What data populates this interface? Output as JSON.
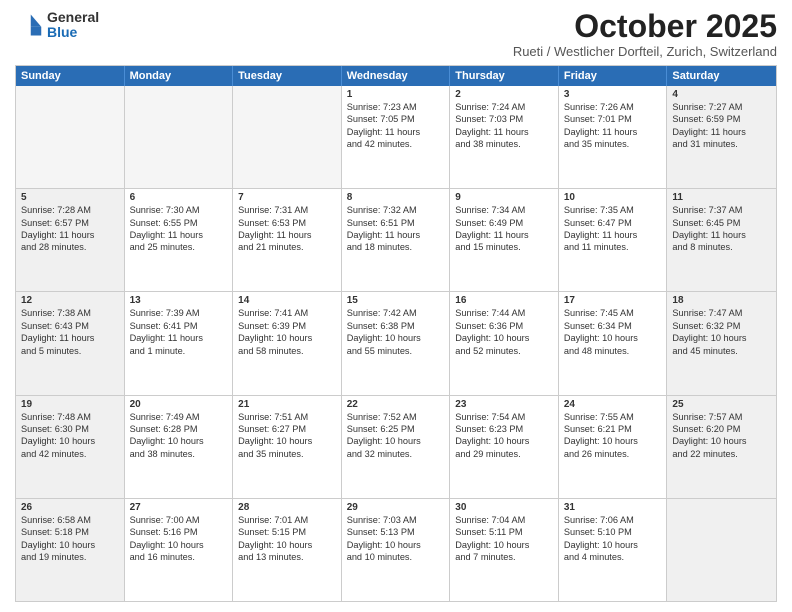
{
  "logo": {
    "general": "General",
    "blue": "Blue"
  },
  "title": "October 2025",
  "subtitle": "Rueti / Westlicher Dorfteil, Zurich, Switzerland",
  "days": [
    "Sunday",
    "Monday",
    "Tuesday",
    "Wednesday",
    "Thursday",
    "Friday",
    "Saturday"
  ],
  "rows": [
    [
      {
        "num": "",
        "lines": [],
        "empty": true
      },
      {
        "num": "",
        "lines": [],
        "empty": true
      },
      {
        "num": "",
        "lines": [],
        "empty": true
      },
      {
        "num": "1",
        "lines": [
          "Sunrise: 7:23 AM",
          "Sunset: 7:05 PM",
          "Daylight: 11 hours",
          "and 42 minutes."
        ],
        "empty": false
      },
      {
        "num": "2",
        "lines": [
          "Sunrise: 7:24 AM",
          "Sunset: 7:03 PM",
          "Daylight: 11 hours",
          "and 38 minutes."
        ],
        "empty": false
      },
      {
        "num": "3",
        "lines": [
          "Sunrise: 7:26 AM",
          "Sunset: 7:01 PM",
          "Daylight: 11 hours",
          "and 35 minutes."
        ],
        "empty": false
      },
      {
        "num": "4",
        "lines": [
          "Sunrise: 7:27 AM",
          "Sunset: 6:59 PM",
          "Daylight: 11 hours",
          "and 31 minutes."
        ],
        "empty": false,
        "shaded": true
      }
    ],
    [
      {
        "num": "5",
        "lines": [
          "Sunrise: 7:28 AM",
          "Sunset: 6:57 PM",
          "Daylight: 11 hours",
          "and 28 minutes."
        ],
        "empty": false,
        "shaded": true
      },
      {
        "num": "6",
        "lines": [
          "Sunrise: 7:30 AM",
          "Sunset: 6:55 PM",
          "Daylight: 11 hours",
          "and 25 minutes."
        ],
        "empty": false
      },
      {
        "num": "7",
        "lines": [
          "Sunrise: 7:31 AM",
          "Sunset: 6:53 PM",
          "Daylight: 11 hours",
          "and 21 minutes."
        ],
        "empty": false
      },
      {
        "num": "8",
        "lines": [
          "Sunrise: 7:32 AM",
          "Sunset: 6:51 PM",
          "Daylight: 11 hours",
          "and 18 minutes."
        ],
        "empty": false
      },
      {
        "num": "9",
        "lines": [
          "Sunrise: 7:34 AM",
          "Sunset: 6:49 PM",
          "Daylight: 11 hours",
          "and 15 minutes."
        ],
        "empty": false
      },
      {
        "num": "10",
        "lines": [
          "Sunrise: 7:35 AM",
          "Sunset: 6:47 PM",
          "Daylight: 11 hours",
          "and 11 minutes."
        ],
        "empty": false
      },
      {
        "num": "11",
        "lines": [
          "Sunrise: 7:37 AM",
          "Sunset: 6:45 PM",
          "Daylight: 11 hours",
          "and 8 minutes."
        ],
        "empty": false,
        "shaded": true
      }
    ],
    [
      {
        "num": "12",
        "lines": [
          "Sunrise: 7:38 AM",
          "Sunset: 6:43 PM",
          "Daylight: 11 hours",
          "and 5 minutes."
        ],
        "empty": false,
        "shaded": true
      },
      {
        "num": "13",
        "lines": [
          "Sunrise: 7:39 AM",
          "Sunset: 6:41 PM",
          "Daylight: 11 hours",
          "and 1 minute."
        ],
        "empty": false
      },
      {
        "num": "14",
        "lines": [
          "Sunrise: 7:41 AM",
          "Sunset: 6:39 PM",
          "Daylight: 10 hours",
          "and 58 minutes."
        ],
        "empty": false
      },
      {
        "num": "15",
        "lines": [
          "Sunrise: 7:42 AM",
          "Sunset: 6:38 PM",
          "Daylight: 10 hours",
          "and 55 minutes."
        ],
        "empty": false
      },
      {
        "num": "16",
        "lines": [
          "Sunrise: 7:44 AM",
          "Sunset: 6:36 PM",
          "Daylight: 10 hours",
          "and 52 minutes."
        ],
        "empty": false
      },
      {
        "num": "17",
        "lines": [
          "Sunrise: 7:45 AM",
          "Sunset: 6:34 PM",
          "Daylight: 10 hours",
          "and 48 minutes."
        ],
        "empty": false
      },
      {
        "num": "18",
        "lines": [
          "Sunrise: 7:47 AM",
          "Sunset: 6:32 PM",
          "Daylight: 10 hours",
          "and 45 minutes."
        ],
        "empty": false,
        "shaded": true
      }
    ],
    [
      {
        "num": "19",
        "lines": [
          "Sunrise: 7:48 AM",
          "Sunset: 6:30 PM",
          "Daylight: 10 hours",
          "and 42 minutes."
        ],
        "empty": false,
        "shaded": true
      },
      {
        "num": "20",
        "lines": [
          "Sunrise: 7:49 AM",
          "Sunset: 6:28 PM",
          "Daylight: 10 hours",
          "and 38 minutes."
        ],
        "empty": false
      },
      {
        "num": "21",
        "lines": [
          "Sunrise: 7:51 AM",
          "Sunset: 6:27 PM",
          "Daylight: 10 hours",
          "and 35 minutes."
        ],
        "empty": false
      },
      {
        "num": "22",
        "lines": [
          "Sunrise: 7:52 AM",
          "Sunset: 6:25 PM",
          "Daylight: 10 hours",
          "and 32 minutes."
        ],
        "empty": false
      },
      {
        "num": "23",
        "lines": [
          "Sunrise: 7:54 AM",
          "Sunset: 6:23 PM",
          "Daylight: 10 hours",
          "and 29 minutes."
        ],
        "empty": false
      },
      {
        "num": "24",
        "lines": [
          "Sunrise: 7:55 AM",
          "Sunset: 6:21 PM",
          "Daylight: 10 hours",
          "and 26 minutes."
        ],
        "empty": false
      },
      {
        "num": "25",
        "lines": [
          "Sunrise: 7:57 AM",
          "Sunset: 6:20 PM",
          "Daylight: 10 hours",
          "and 22 minutes."
        ],
        "empty": false,
        "shaded": true
      }
    ],
    [
      {
        "num": "26",
        "lines": [
          "Sunrise: 6:58 AM",
          "Sunset: 5:18 PM",
          "Daylight: 10 hours",
          "and 19 minutes."
        ],
        "empty": false,
        "shaded": true
      },
      {
        "num": "27",
        "lines": [
          "Sunrise: 7:00 AM",
          "Sunset: 5:16 PM",
          "Daylight: 10 hours",
          "and 16 minutes."
        ],
        "empty": false
      },
      {
        "num": "28",
        "lines": [
          "Sunrise: 7:01 AM",
          "Sunset: 5:15 PM",
          "Daylight: 10 hours",
          "and 13 minutes."
        ],
        "empty": false
      },
      {
        "num": "29",
        "lines": [
          "Sunrise: 7:03 AM",
          "Sunset: 5:13 PM",
          "Daylight: 10 hours",
          "and 10 minutes."
        ],
        "empty": false
      },
      {
        "num": "30",
        "lines": [
          "Sunrise: 7:04 AM",
          "Sunset: 5:11 PM",
          "Daylight: 10 hours",
          "and 7 minutes."
        ],
        "empty": false
      },
      {
        "num": "31",
        "lines": [
          "Sunrise: 7:06 AM",
          "Sunset: 5:10 PM",
          "Daylight: 10 hours",
          "and 4 minutes."
        ],
        "empty": false
      },
      {
        "num": "",
        "lines": [],
        "empty": true,
        "shaded": true
      }
    ]
  ]
}
